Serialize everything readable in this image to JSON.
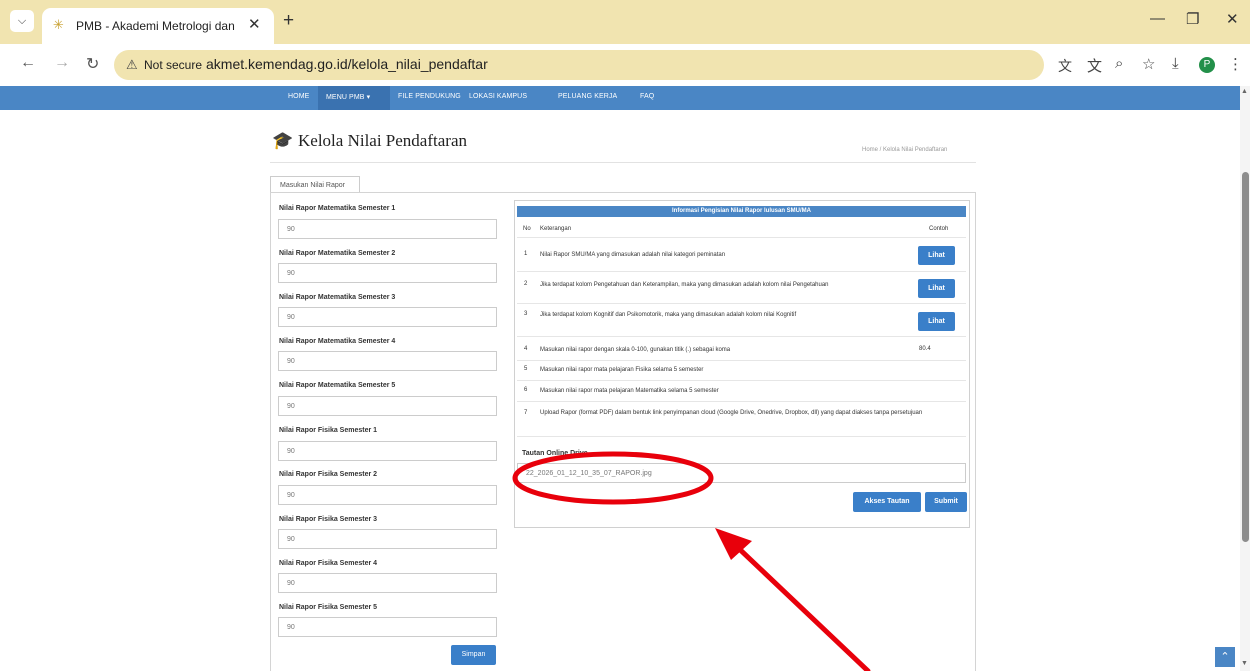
{
  "browser": {
    "tab_title": "PMB - Akademi Metrologi dan",
    "security_label": "Not secure",
    "url": "akmet.kemendag.go.id/kelola_nilai_pendaftar",
    "profile_initial": "P"
  },
  "site_nav": {
    "items": [
      "HOME",
      "MENU PMB",
      "FILE PENDUKUNG",
      "LOKASI KAMPUS",
      "PELUANG KERJA",
      "FAQ"
    ]
  },
  "page": {
    "title": "Kelola Nilai Pendaftaran",
    "breadcrumb": "Home / Kelola Nilai Pendaftaran",
    "form_tab": "Masukan Nilai Rapor"
  },
  "form": {
    "fields": [
      {
        "label": "Nilai Rapor Matematika Semester 1",
        "value": "90"
      },
      {
        "label": "Nilai Rapor Matematika Semester 2",
        "value": "90"
      },
      {
        "label": "Nilai Rapor Matematika Semester 3",
        "value": "90"
      },
      {
        "label": "Nilai Rapor Matematika Semester 4",
        "value": "90"
      },
      {
        "label": "Nilai Rapor Matematika Semester 5",
        "value": "90"
      },
      {
        "label": "Nilai Rapor Fisika Semester 1",
        "value": "90"
      },
      {
        "label": "Nilai Rapor Fisika Semester 2",
        "value": "90"
      },
      {
        "label": "Nilai Rapor Fisika Semester 3",
        "value": "90"
      },
      {
        "label": "Nilai Rapor Fisika Semester 4",
        "value": "90"
      },
      {
        "label": "Nilai Rapor Fisika Semester 5",
        "value": "90"
      }
    ],
    "save_label": "Simpan"
  },
  "info": {
    "title": "Informasi Pengisian Nilai Rapor lulusan SMU/MA",
    "col_no": "No",
    "col_desc": "Keterangan",
    "col_example": "Contoh",
    "rows": [
      {
        "no": "1",
        "text": "Nilai Rapor SMU/MA yang dimasukan adalah nilai kategori peminatan",
        "example": "",
        "button": "Lihat"
      },
      {
        "no": "2",
        "text": "Jika terdapat kolom Pengetahuan dan Keterampilan, maka yang dimasukan adalah kolom nilai Pengetahuan",
        "example": "",
        "button": "Lihat"
      },
      {
        "no": "3",
        "text": "Jika terdapat kolom Kognitif dan Psikomotorik, maka yang dimasukan adalah kolom nilai Kognitif",
        "example": "",
        "button": "Lihat"
      },
      {
        "no": "4",
        "text": "Masukan nilai rapor dengan skala 0-100, gunakan titik (.) sebagai koma",
        "example": "80.4",
        "button": ""
      },
      {
        "no": "5",
        "text": "Masukan nilai rapor mata pelajaran Fisika selama 5 semester",
        "example": "",
        "button": ""
      },
      {
        "no": "6",
        "text": "Masukan nilai rapor mata pelajaran Matematika selama 5 semester",
        "example": "",
        "button": ""
      },
      {
        "no": "7",
        "text": "Upload Rapor (format PDF) dalam bentuk link penyimpanan cloud (Google Drive, Onedrive, Dropbox, dll) yang dapat diakses tanpa persetujuan",
        "example": "",
        "button": ""
      }
    ],
    "link_label": "Tautan Online Drive",
    "link_value": "22_2026_01_12_10_35_07_RAPOR.jpg",
    "access_label": "Akses Tautan",
    "submit_label": "Submit"
  },
  "colors": {
    "nav_blue": "#4a86c5",
    "button_blue": "#3a7fc9",
    "annotation_red": "#e8000b",
    "chrome_tan": "#f1e4b0"
  }
}
